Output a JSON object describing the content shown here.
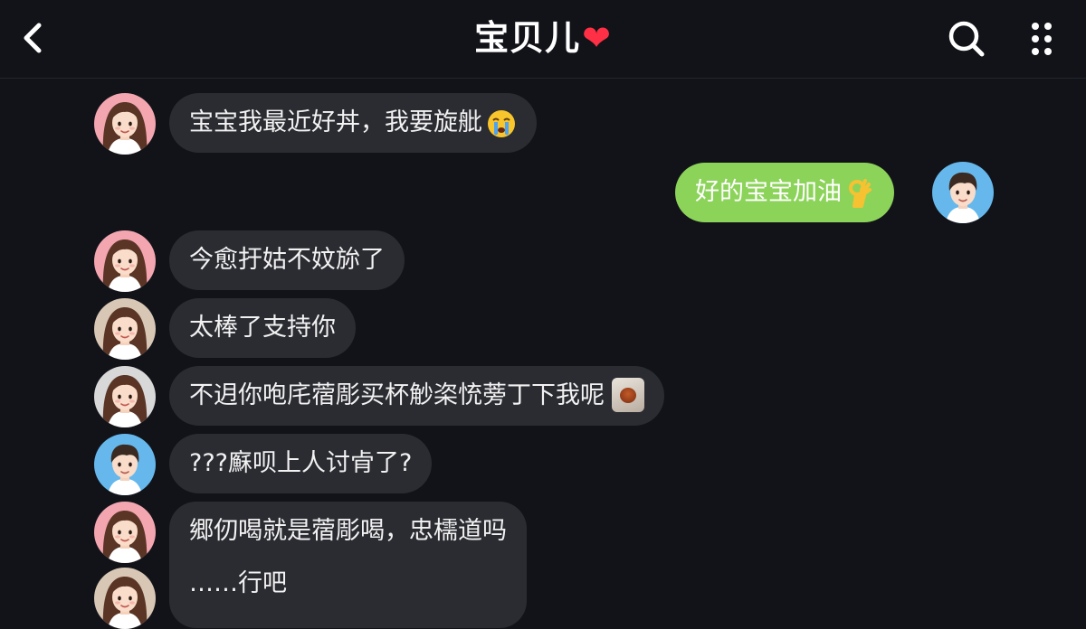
{
  "header": {
    "title": "宝贝儿",
    "heart": "❤"
  },
  "messages": [
    {
      "text": "宝宝我最近好丼，我要旋舭",
      "emoji": "crying-face"
    },
    {
      "text": "好的宝宝加油",
      "emoji": "ok-hand"
    },
    {
      "text": "今愈扜姑不妏旀了"
    },
    {
      "text": "太棒了支持你"
    },
    {
      "text": "不迌你咆㡯蓿彫买杯觘栥㤝蒡丁下我呢",
      "attachment": "photo-thumbnail"
    },
    {
      "text": "???㢝呗上人讨肻了?"
    },
    {
      "lines": [
        "郷仞喝就是蓿彫喝，忠檽道吗",
        "……行吧"
      ]
    }
  ],
  "colors": {
    "background": "#121319",
    "bubble_other": "#2b2c32",
    "bubble_self": "#8cd35a",
    "heart": "#ff2f45",
    "avatar_female_bg": "#f3a6b0",
    "avatar_male_bg": "#66b8ec"
  }
}
